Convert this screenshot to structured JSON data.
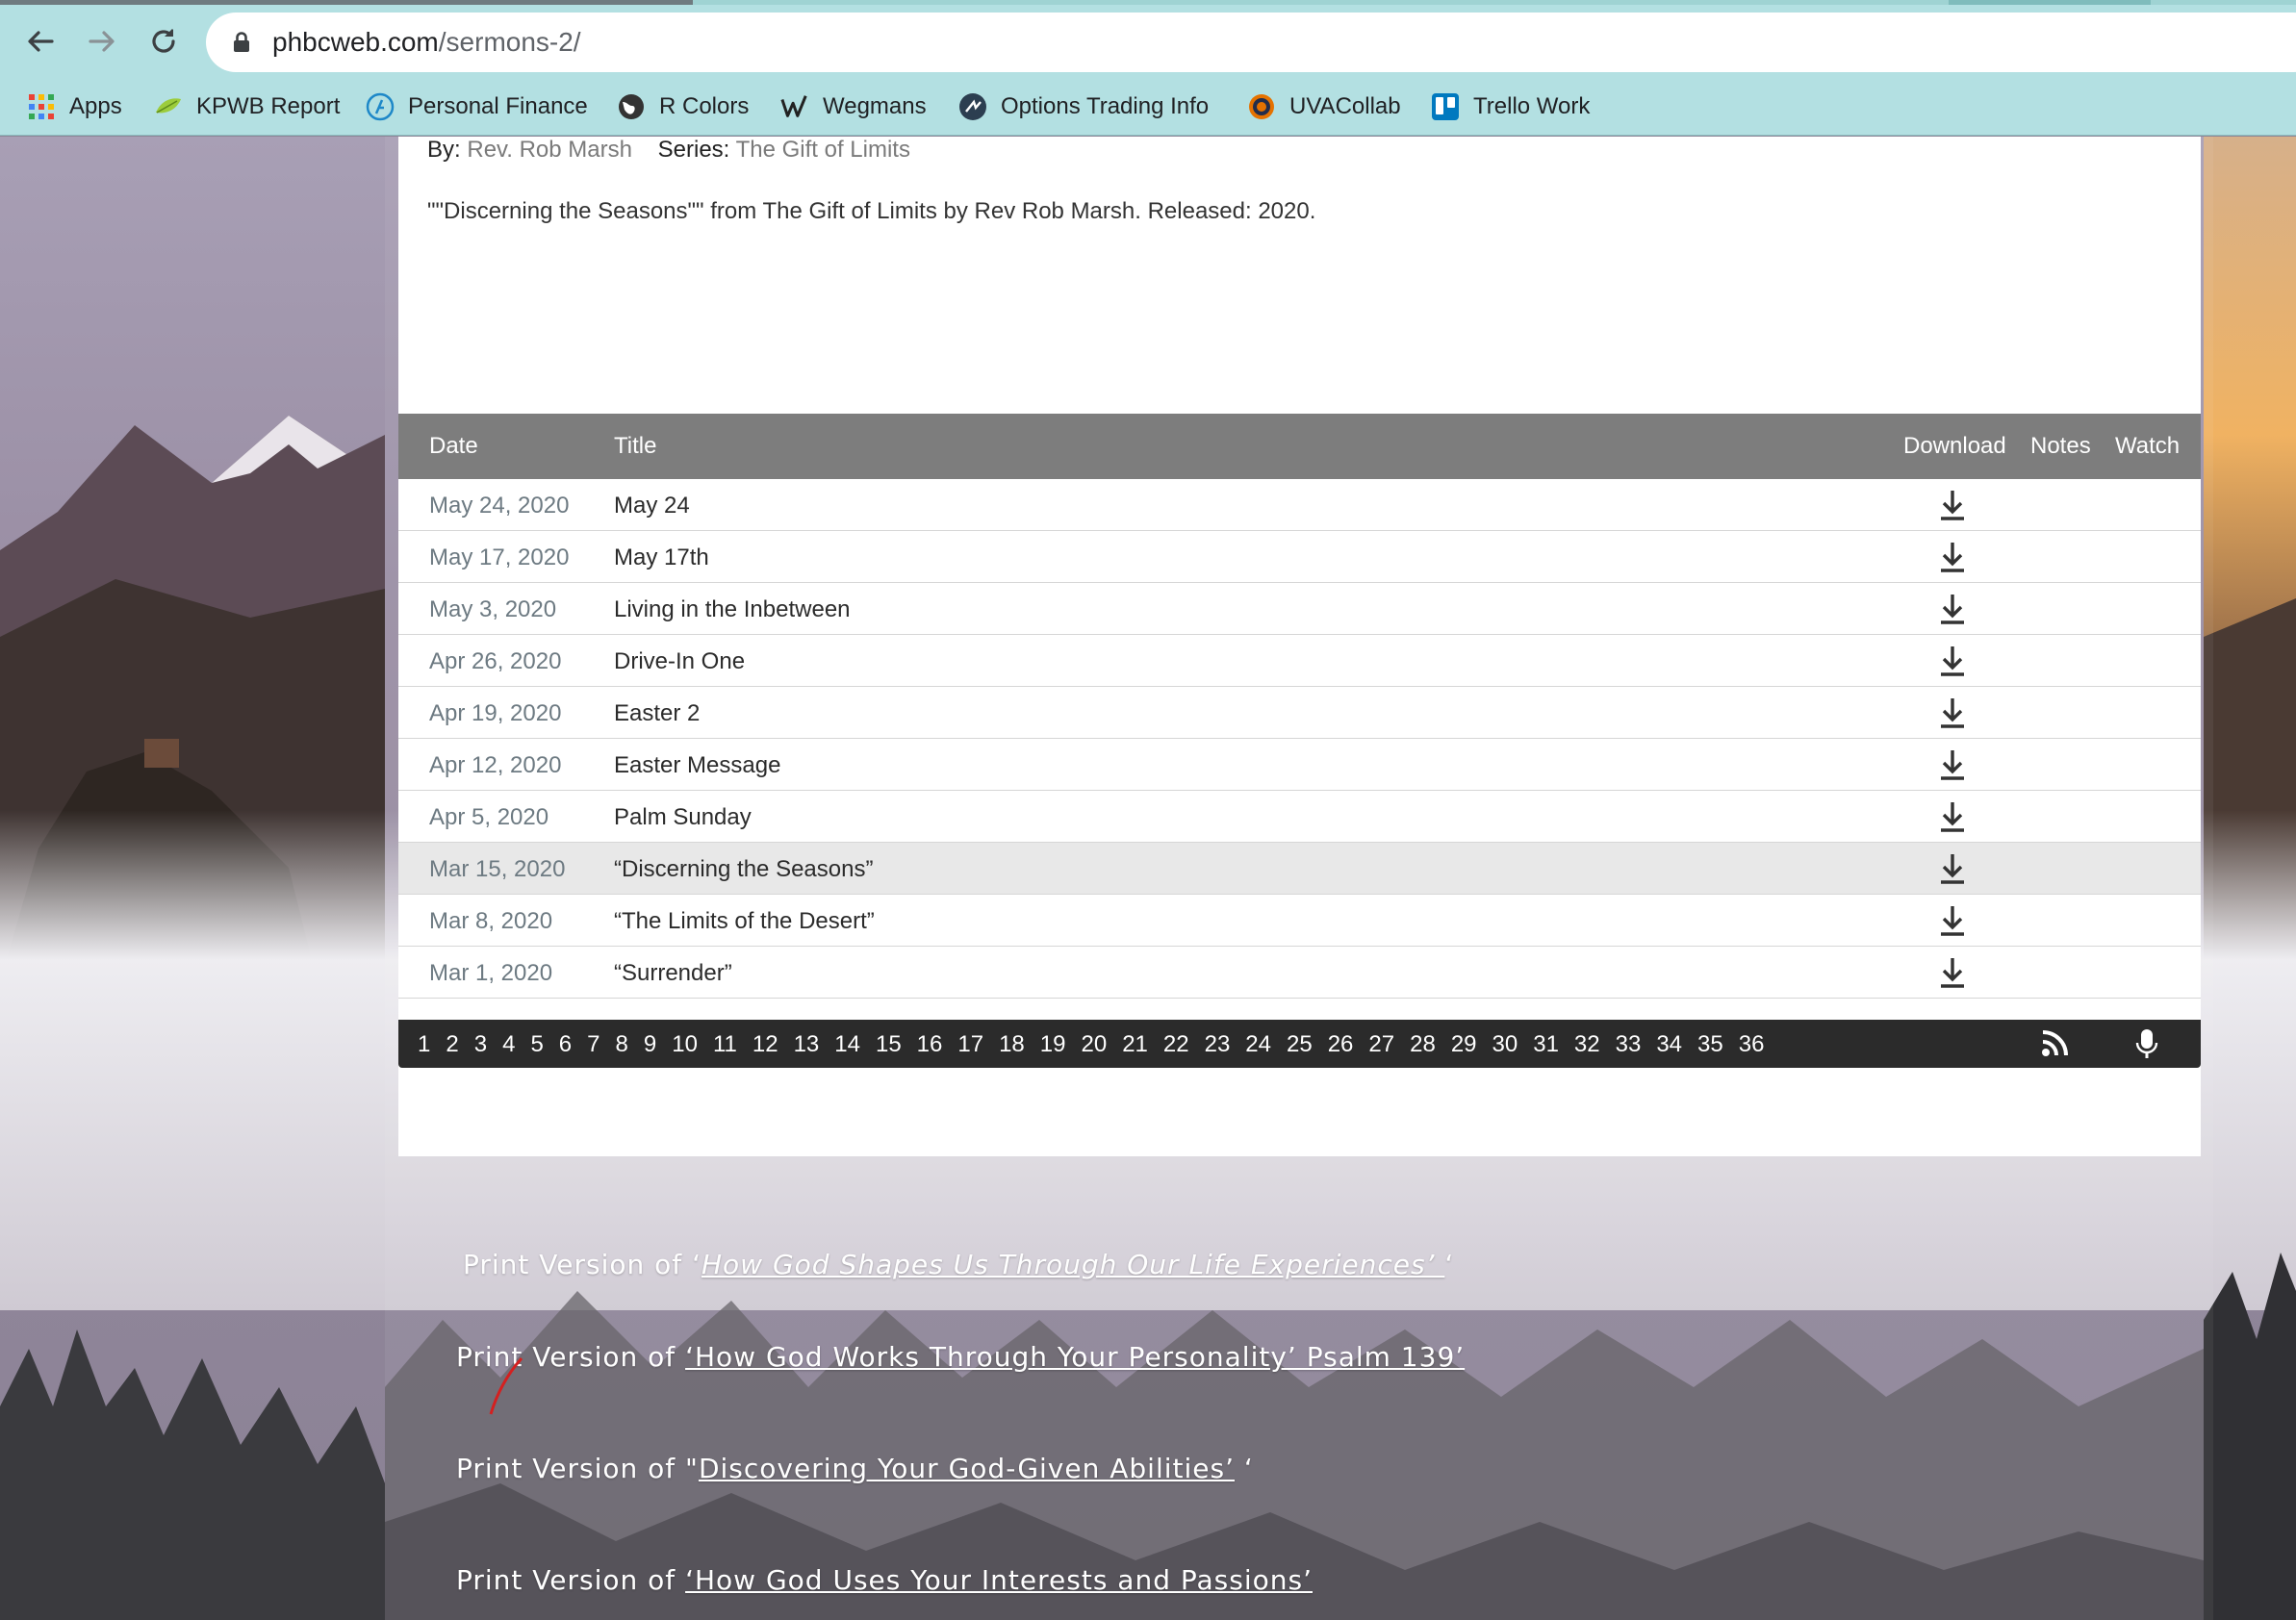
{
  "browser": {
    "url_host": "phbcweb.com",
    "url_path": "/sermons-2/",
    "bookmarks": [
      "Apps",
      "KPWB Report",
      "Personal Finance",
      "R Colors",
      "Wegmans",
      "Options Trading Info",
      "UVACollab",
      "Trello Work"
    ]
  },
  "sermon": {
    "by_label": "By:",
    "author": "Rev. Rob Marsh",
    "series_label": "Series:",
    "series": "The Gift of Limits",
    "description": "\"\"Discerning the Seasons\"\" from The Gift of Limits by Rev Rob Marsh. Released: 2020."
  },
  "table": {
    "headers": {
      "date": "Date",
      "title": "Title",
      "download": "Download",
      "notes": "Notes",
      "watch": "Watch"
    },
    "rows": [
      {
        "date": "May 24, 2020",
        "title": "May 24"
      },
      {
        "date": "May 17, 2020",
        "title": "May 17th"
      },
      {
        "date": "May 3, 2020",
        "title": "Living in the Inbetween"
      },
      {
        "date": "Apr 26, 2020",
        "title": "Drive-In One"
      },
      {
        "date": "Apr 19, 2020",
        "title": "Easter 2"
      },
      {
        "date": "Apr 12, 2020",
        "title": "Easter Message"
      },
      {
        "date": "Apr 5, 2020",
        "title": "Palm Sunday"
      },
      {
        "date": "Mar 15, 2020",
        "title": "“Discerning the Seasons”"
      },
      {
        "date": "Mar 8, 2020",
        "title": "“The Limits of the Desert”"
      },
      {
        "date": "Mar 1, 2020",
        "title": "“Surrender”"
      }
    ],
    "highlighted_row": 7
  },
  "pagination": [
    "1",
    "2",
    "3",
    "4",
    "5",
    "6",
    "7",
    "8",
    "9",
    "10",
    "11",
    "12",
    "13",
    "14",
    "15",
    "16",
    "17",
    "18",
    "19",
    "20",
    "21",
    "22",
    "23",
    "24",
    "25",
    "26",
    "27",
    "28",
    "29",
    "30",
    "31",
    "32",
    "33",
    "34",
    "35",
    "36"
  ],
  "print_links": [
    {
      "prefix": "Print Version of ",
      "open": "‘",
      "link": "How God Shapes Us Through Our Life Experiences’ ",
      "close": "‘"
    },
    {
      "prefix": "Print Version of ",
      "open": "",
      "link": "‘How God Works Through Your Personality’ Psalm 139’",
      "close": ""
    },
    {
      "prefix": "Print Version of \"",
      "open": "",
      "link": "Discovering Your God-Given Abilities’",
      "close": " ‘"
    },
    {
      "prefix": "Print Version of ",
      "open": "",
      "link": "‘How God Uses Your Interests and Passions’",
      "close": ""
    }
  ],
  "colors": {
    "toolbar": "#b3e0e2",
    "table_header": "#7d7d7d",
    "pager": "#2b2b2b",
    "highlight_row": "#e8e8e8"
  },
  "icons": [
    "back-arrow-icon",
    "forward-arrow-icon",
    "reload-icon",
    "lock-icon",
    "download-icon",
    "rss-icon",
    "microphone-icon"
  ]
}
